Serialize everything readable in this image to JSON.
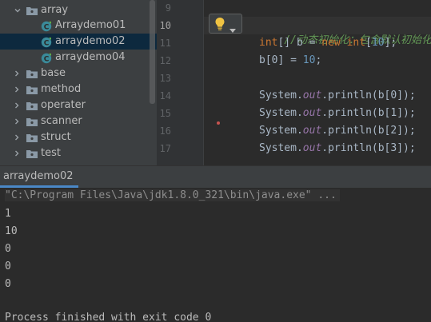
{
  "project_tree": {
    "items": [
      {
        "label": "array",
        "kind": "folder",
        "expanded": true
      },
      {
        "label": "Arraydemo01",
        "kind": "class"
      },
      {
        "label": "arraydemo02",
        "kind": "class",
        "selected": true
      },
      {
        "label": "arraydemo04",
        "kind": "class"
      },
      {
        "label": "base",
        "kind": "folder",
        "expanded": false
      },
      {
        "label": "method",
        "kind": "folder",
        "expanded": false
      },
      {
        "label": "operater",
        "kind": "folder",
        "expanded": false
      },
      {
        "label": "scanner",
        "kind": "folder",
        "expanded": false
      },
      {
        "label": "struct",
        "kind": "folder",
        "expanded": false
      },
      {
        "label": "test",
        "kind": "folder",
        "expanded": false
      }
    ]
  },
  "editor": {
    "line_numbers": [
      "9",
      "10",
      "11",
      "12",
      "13",
      "14",
      "15",
      "16",
      "17"
    ],
    "code": {
      "comment": "//动态初始化：包含默认初始化",
      "l11_type": "int",
      "l11_mid": "[] b = ",
      "l11_new": "new",
      "l11_type2": " int",
      "l11_open": "[",
      "l11_size": "10",
      "l11_close": "];",
      "l12_left": "b[0] = ",
      "l12_value": "10",
      "l12_end": ";",
      "print_prefix": "System.",
      "print_field": "out",
      "print_lines": [
        ".println(b[0]);",
        ".println(b[1]);",
        ".println(b[2]);",
        ".println(b[3]);"
      ]
    }
  },
  "run_panel": {
    "tab_label": "arraydemo02",
    "command": "\"C:\\Program Files\\Java\\jdk1.8.0_321\\bin\\java.exe\" ...",
    "output_lines": [
      "1",
      "10",
      "0",
      "0",
      "0"
    ],
    "finish_message": "Process finished with exit code 0"
  },
  "colors": {
    "keyword": "#cc7832",
    "number": "#6897bb",
    "comment": "#629755",
    "static_field": "#9876aa",
    "selection": "#0d293e",
    "bulb": "#f0c342"
  }
}
